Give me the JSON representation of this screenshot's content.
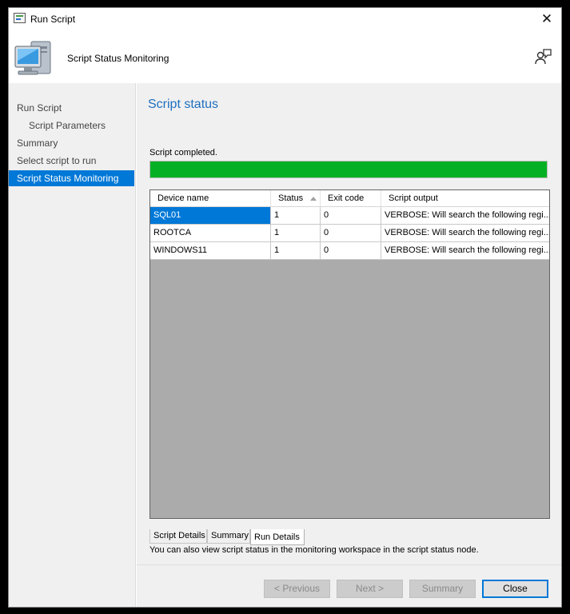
{
  "window": {
    "title": "Run Script"
  },
  "header": {
    "title": "Script Status Monitoring"
  },
  "nav": {
    "items": [
      {
        "label": "Run Script"
      },
      {
        "label": "Script Parameters"
      },
      {
        "label": "Summary"
      },
      {
        "label": "Select script to run"
      },
      {
        "label": "Script Status Monitoring"
      }
    ]
  },
  "content": {
    "title": "Script status",
    "status_text": "Script completed.",
    "progress": 1.0,
    "progress_color": "#06b025",
    "note": "You can also view script status in the monitoring workspace in the script status node."
  },
  "grid": {
    "columns": [
      "Device name",
      "Status",
      "Exit code",
      "Script output"
    ],
    "rows": [
      [
        "SQL01",
        "1",
        "0",
        "VERBOSE: Will search the following regi..."
      ],
      [
        "ROOTCA",
        "1",
        "0",
        "VERBOSE: Will search the following regi..."
      ],
      [
        "WINDOWS11",
        "1",
        "0",
        "VERBOSE: Will search the following regi..."
      ]
    ]
  },
  "tabs": [
    "Script Details",
    "Summary",
    "Run Details"
  ],
  "buttons": {
    "previous": "< Previous",
    "next": "Next >",
    "summary": "Summary",
    "close": "Close"
  },
  "colors": {
    "accent": "#0078d7",
    "title_blue": "#1f6fbf"
  }
}
